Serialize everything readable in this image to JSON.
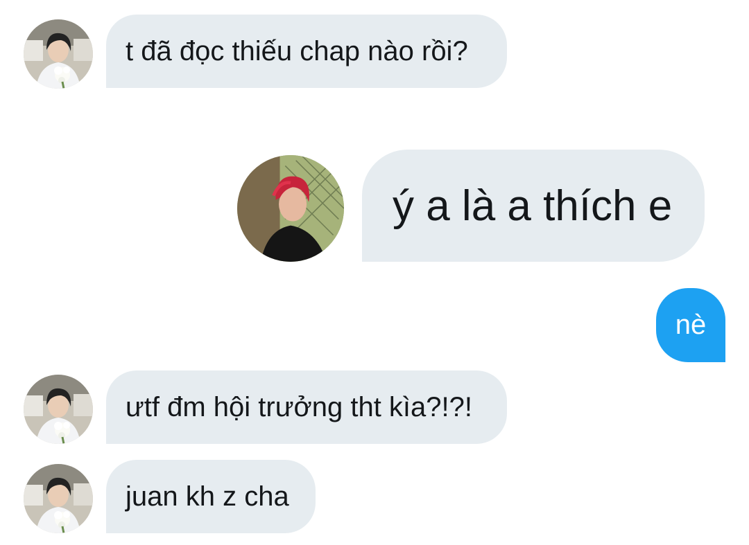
{
  "conversation": {
    "messages": [
      {
        "direction": "incoming",
        "text": "t đã đọc thiếu chap nào rồi?",
        "avatar": "avatar-boy-with-flowers"
      },
      {
        "direction": "quoted",
        "text": "ý a là a thích e",
        "avatar": "avatar-red-hair-boy"
      },
      {
        "direction": "outgoing",
        "text": "nè"
      },
      {
        "direction": "incoming",
        "text": "ưtf đm hội trưởng tht kìa?!?!",
        "avatar": "avatar-boy-with-flowers"
      },
      {
        "direction": "incoming",
        "text": "juan kh z cha",
        "avatar": "avatar-boy-with-flowers"
      }
    ]
  },
  "colors": {
    "incoming_bubble": "#e6ecf0",
    "outgoing_bubble": "#1da1f2",
    "text_dark": "#14171a",
    "text_light": "#ffffff"
  }
}
